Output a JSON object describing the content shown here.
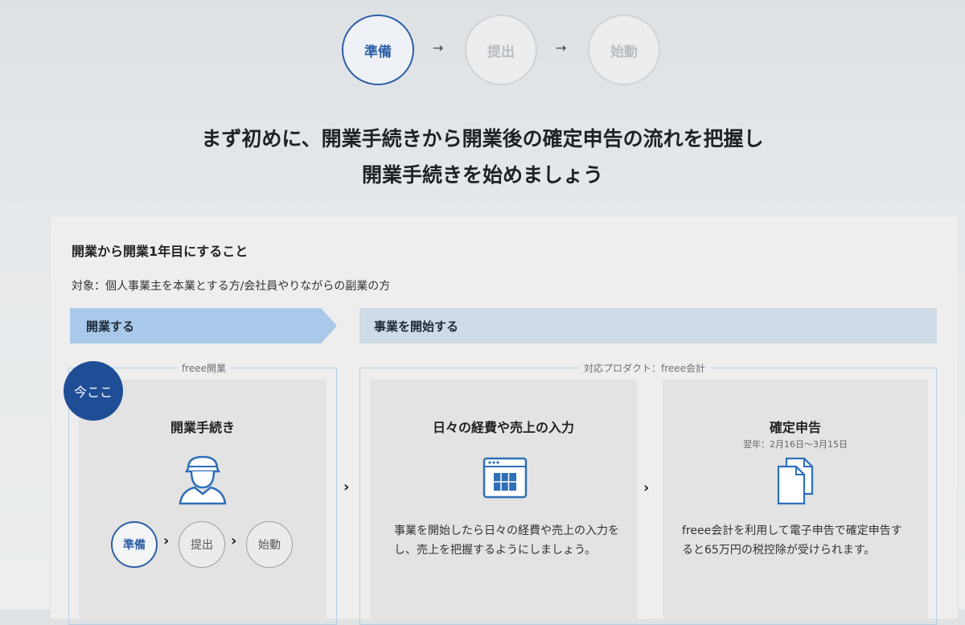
{
  "top_steps": {
    "step1": "準備",
    "step2": "提出",
    "step3": "始動",
    "arrow": "→"
  },
  "headline": {
    "line1": "まず初めに、開業手続きから開業後の確定申告の流れを把握し",
    "line2": "開業手続きを始めましょう"
  },
  "card": {
    "title": "開業から開業1年目にすること",
    "target": "対象：個人事業主を本業とする方/会社員やりながらの副業の方",
    "banner_left": "開業する",
    "banner_right": "事業を開始する",
    "box_left_label": "freee開業",
    "box_right_label": "対応プロダクト：freee会計",
    "now_badge": "今ここ",
    "panel1": {
      "title": "開業手続き",
      "step1": "準備",
      "step2": "提出",
      "step3": "始動"
    },
    "panel2": {
      "title": "日々の経費や売上の入力",
      "desc": "事業を開始したら日々の経費や売上の入力をし、売上を把握するようにしましょう。"
    },
    "panel3": {
      "title": "確定申告",
      "subtitle": "翌年：2月16日〜3月15日",
      "desc": "freee会計を利用して電子申告で確定申告すると65万円の税控除が受けられます。"
    },
    "chevron": "›"
  },
  "colors": {
    "accent": "#2d5fa6",
    "badge": "#1f4e97",
    "banner_left": "#a9c9ea",
    "banner_right": "#cfdbe6"
  }
}
